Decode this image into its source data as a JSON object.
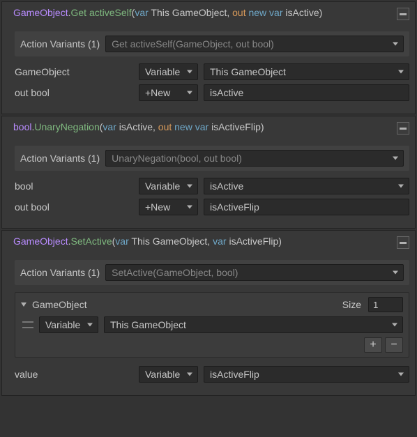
{
  "blocks": [
    {
      "title": {
        "class": "GameObject",
        "method": "Get activeSelf",
        "argspan": "var This GameObject, out new var isActive"
      },
      "variants_label": "Action Variants (1)",
      "variants_value": "Get activeSelf(GameObject, out bool)",
      "rows": [
        {
          "label": "GameObject",
          "mode": "Variable",
          "value": "This GameObject",
          "valueIsSel": true
        },
        {
          "label": "out bool",
          "mode": "+New",
          "value": "isActive",
          "valueIsSel": false
        }
      ]
    },
    {
      "title": {
        "class": "bool",
        "method": "UnaryNegation",
        "argspan": "var isActive, out new var isActiveFlip"
      },
      "variants_label": "Action Variants (1)",
      "variants_value": "UnaryNegation(bool, out bool)",
      "rows": [
        {
          "label": "bool",
          "mode": "Variable",
          "value": "isActive",
          "valueIsSel": true
        },
        {
          "label": "out bool",
          "mode": "+New",
          "value": "isActiveFlip",
          "valueIsSel": false
        }
      ]
    },
    {
      "title": {
        "class": "GameObject",
        "method": "SetActive",
        "argspan": "var This GameObject, var isActiveFlip"
      },
      "variants_label": "Action Variants (1)",
      "variants_value": "SetActive(GameObject, bool)",
      "array": {
        "name": "GameObject",
        "size_label": "Size",
        "size": "1",
        "item": {
          "mode": "Variable",
          "value": "This GameObject"
        }
      },
      "valueRow": {
        "label": "value",
        "mode": "Variable",
        "value": "isActiveFlip"
      }
    }
  ]
}
